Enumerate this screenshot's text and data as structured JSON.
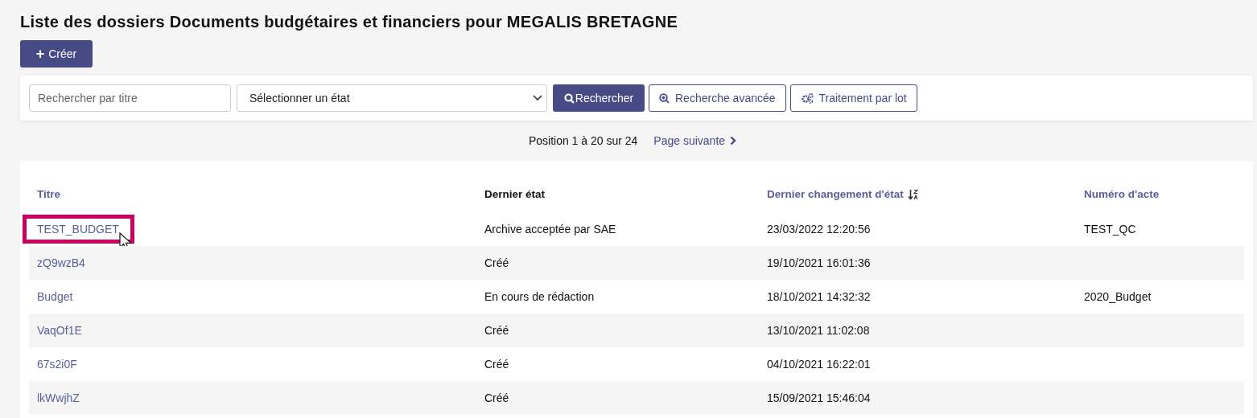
{
  "title": "Liste des dossiers Documents budgétaires et financiers pour MEGALIS BRETAGNE",
  "create_button": {
    "icon": "+",
    "label": "Créer"
  },
  "search": {
    "placeholder": "Rechercher par titre",
    "state_select": "Sélectionner un état",
    "buttons": [
      {
        "kind": "search",
        "label": "Rechercher"
      },
      {
        "kind": "advanced",
        "label": "Recherche avancée"
      },
      {
        "kind": "batch",
        "label": "Traitement par lot"
      }
    ]
  },
  "pagination": {
    "position": "Position 1 à 20 sur 24",
    "next": "Page suivante"
  },
  "table": {
    "columns": [
      {
        "label": "Titre",
        "sortable": true,
        "sorted": false
      },
      {
        "label": "Dernier état",
        "sortable": false,
        "sorted": false
      },
      {
        "label": "Dernier changement d'état",
        "sortable": true,
        "sorted": true
      },
      {
        "label": "Numéro d'acte",
        "sortable": true,
        "sorted": false
      }
    ],
    "rows": [
      {
        "cells": [
          "TEST_BUDGET",
          "Archive acceptée par SAE",
          "23/03/2022 12:20:56",
          "TEST_QC"
        ],
        "highlighted": true
      },
      {
        "cells": [
          "zQ9wzB4",
          "Créé",
          "19/10/2021 16:01:36",
          ""
        ],
        "highlighted": false
      },
      {
        "cells": [
          "Budget",
          "En cours de rédaction",
          "18/10/2021 14:32:32",
          "2020_Budget"
        ],
        "highlighted": false
      },
      {
        "cells": [
          "VaqOf1E",
          "Créé",
          "13/10/2021 11:02:08",
          ""
        ],
        "highlighted": false
      },
      {
        "cells": [
          "67s2i0F",
          "Créé",
          "04/10/2021 16:22:01",
          ""
        ],
        "highlighted": false
      },
      {
        "cells": [
          "lkWwjhZ",
          "Créé",
          "15/09/2021 15:46:04",
          ""
        ],
        "highlighted": false
      }
    ]
  }
}
